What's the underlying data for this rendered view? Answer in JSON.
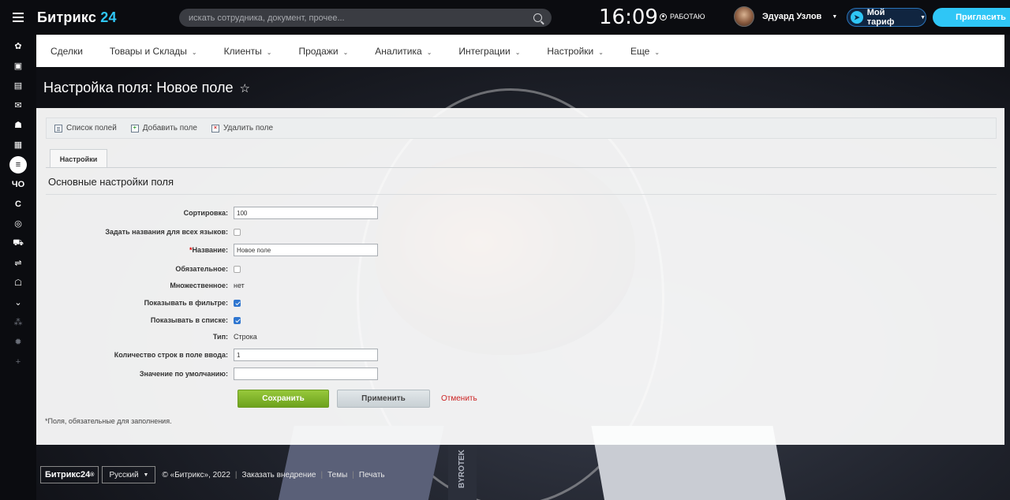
{
  "app": {
    "name": "Битрикс",
    "name_num": "24"
  },
  "search": {
    "placeholder": "искать сотрудника, документ, прочее..."
  },
  "header": {
    "time": "16:09",
    "status": "РАБОТАЮ",
    "user_name": "Эдуард Узлов",
    "plan_label": "Мой тариф",
    "invite_label": "Пригласить"
  },
  "sidebar": {
    "items": [
      {
        "icon": "apps-icon"
      },
      {
        "icon": "calendar-icon"
      },
      {
        "icon": "inbox-icon"
      },
      {
        "icon": "mail-icon"
      },
      {
        "icon": "team-icon"
      },
      {
        "icon": "document-icon"
      },
      {
        "icon": "filter-icon"
      },
      {
        "text": "ЧО"
      },
      {
        "text": "С"
      },
      {
        "icon": "target-icon"
      },
      {
        "icon": "cart-icon"
      },
      {
        "icon": "sliders-icon"
      },
      {
        "icon": "robot-icon"
      },
      {
        "icon": "chevron-down-icon"
      },
      {
        "icon": "sitemap-icon"
      },
      {
        "icon": "gear-icon"
      },
      {
        "icon": "plus-icon"
      }
    ]
  },
  "menu": {
    "items": [
      {
        "label": "Сделки",
        "has_dropdown": false
      },
      {
        "label": "Товары и Склады",
        "has_dropdown": true
      },
      {
        "label": "Клиенты",
        "has_dropdown": true
      },
      {
        "label": "Продажи",
        "has_dropdown": true
      },
      {
        "label": "Аналитика",
        "has_dropdown": true
      },
      {
        "label": "Интеграции",
        "has_dropdown": true
      },
      {
        "label": "Настройки",
        "has_dropdown": true
      },
      {
        "label": "Еще",
        "has_dropdown": true
      }
    ]
  },
  "page": {
    "title": "Настройка поля: Новое поле"
  },
  "toolbar": {
    "list_label": "Список полей",
    "add_label": "Добавить поле",
    "delete_label": "Удалить поле"
  },
  "tab": {
    "label": "Настройки"
  },
  "section": {
    "title": "Основные настройки поля"
  },
  "form": {
    "sort_label": "Сортировка:",
    "sort_value": "100",
    "all_lang_label": "Задать названия для всех языков:",
    "name_label": "Название:",
    "name_required_mark": "*",
    "name_value": "Новое поле",
    "required_label": "Обязательное:",
    "multiple_label": "Множественное:",
    "multiple_value": "нет",
    "show_filter_label": "Показывать в фильтре:",
    "show_list_label": "Показывать в списке:",
    "type_label": "Тип:",
    "type_value": "Строка",
    "rows_label": "Количество строк в поле ввода:",
    "rows_value": "1",
    "default_label": "Значение по умолчанию:",
    "default_value": ""
  },
  "buttons": {
    "save": "Сохранить",
    "apply": "Применить",
    "cancel": "Отменить"
  },
  "footnote": "*Поля, обязательные для заполнения.",
  "footer": {
    "logo": "Битрикс24",
    "logo_mark": "®",
    "language": "Русский",
    "copyright": "© «Битрикс», 2022",
    "order": "Заказать внедрение",
    "themes": "Темы",
    "print": "Печать"
  },
  "background": {
    "strip_text": "BYROTEK"
  }
}
